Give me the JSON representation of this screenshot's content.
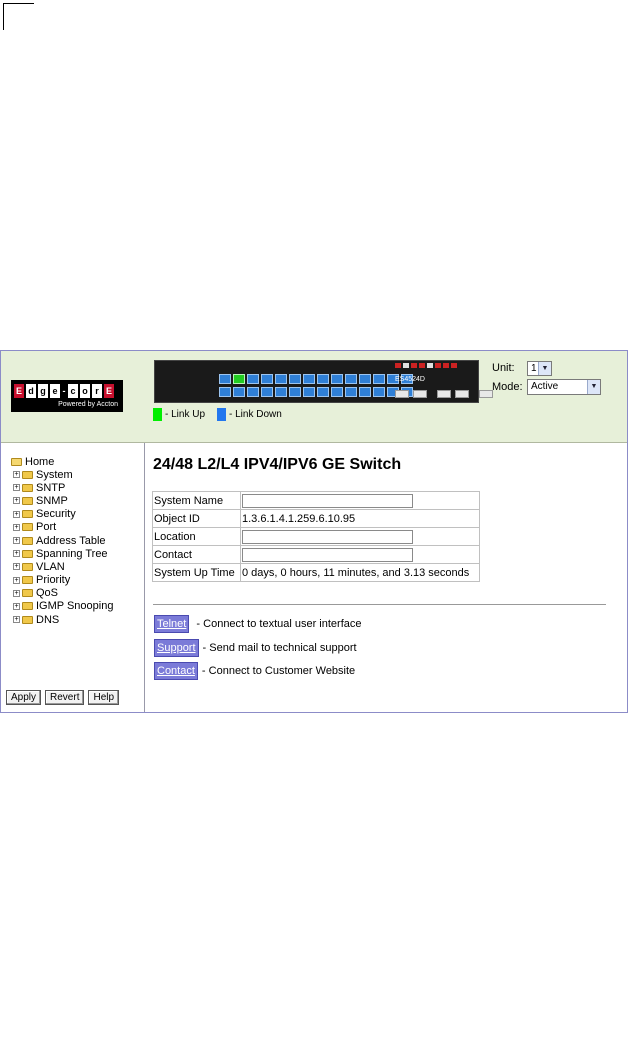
{
  "brand": {
    "logo_letters": [
      "E",
      "d",
      "g",
      "e",
      "-",
      "c",
      "o",
      "r",
      "E"
    ],
    "powered_by": "Powered by Accton"
  },
  "device": {
    "model_label": "ES4524D"
  },
  "legend": {
    "link_up": "- Link Up",
    "link_down": "- Link Down"
  },
  "unit": {
    "label": "Unit:",
    "value": "1"
  },
  "mode": {
    "label": "Mode:",
    "value": "Active"
  },
  "sidebar": {
    "root_label": "Home",
    "items": [
      {
        "label": "System"
      },
      {
        "label": "SNTP"
      },
      {
        "label": "SNMP"
      },
      {
        "label": "Security"
      },
      {
        "label": "Port"
      },
      {
        "label": "Address Table"
      },
      {
        "label": "Spanning Tree"
      },
      {
        "label": "VLAN"
      },
      {
        "label": "Priority"
      },
      {
        "label": "QoS"
      },
      {
        "label": "IGMP Snooping"
      },
      {
        "label": "DNS"
      }
    ],
    "buttons": {
      "apply": "Apply",
      "revert": "Revert",
      "help": "Help"
    }
  },
  "main": {
    "title": "24/48 L2/L4 IPV4/IPV6 GE Switch",
    "system_info": {
      "system_name_label": "System Name",
      "system_name_value": "",
      "object_id_label": "Object ID",
      "object_id_value": "1.3.6.1.4.1.259.6.10.95",
      "location_label": "Location",
      "location_value": "",
      "contact_label": "Contact",
      "contact_value": "",
      "uptime_label": "System Up Time",
      "uptime_value": "0 days, 0 hours, 11 minutes, and 3.13 seconds"
    },
    "links": [
      {
        "button": "Telnet",
        "description": " - Connect to textual user interface"
      },
      {
        "button": "Support",
        "description": "- Send mail to technical support"
      },
      {
        "button": "Contact",
        "description": "- Connect to Customer Website"
      }
    ]
  },
  "colors": {
    "header_bg": "#e7f0d9",
    "link_up": "#00ee00",
    "link_down": "#2277ee",
    "link_button": "#7b7bd8"
  }
}
